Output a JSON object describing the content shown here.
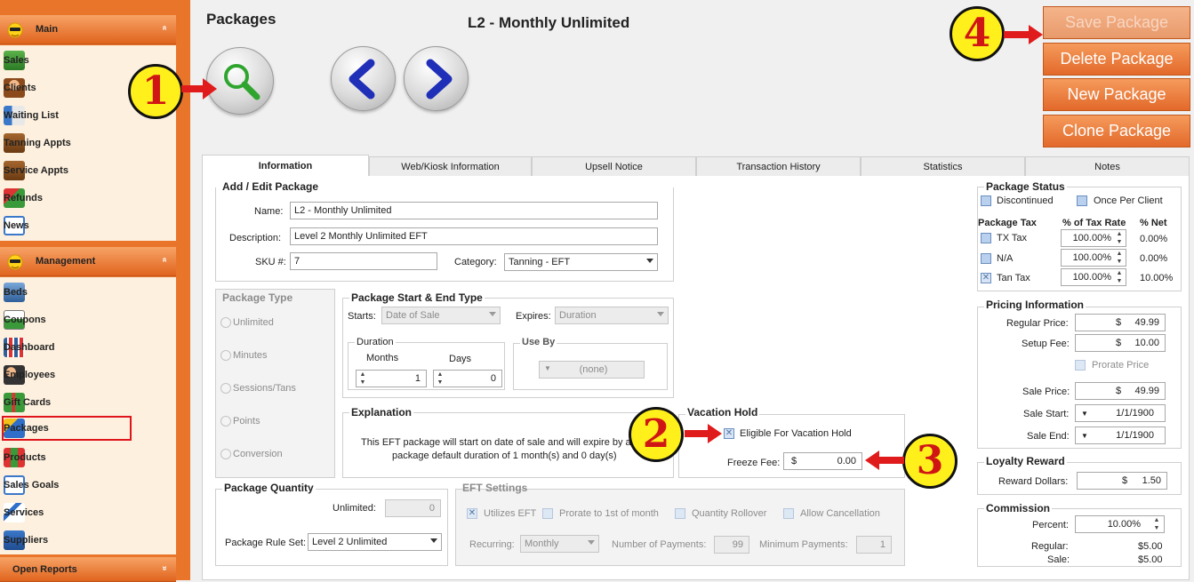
{
  "sidebar": {
    "main_section": {
      "label": "Main",
      "chevron": "»"
    },
    "main_items": [
      {
        "label": "Sales",
        "icon": "sales-icon"
      },
      {
        "label": "Clients",
        "icon": "clients-icon"
      },
      {
        "label": "Waiting List",
        "icon": "waiting-list-icon"
      },
      {
        "label": "Tanning Appts",
        "icon": "tanning-appts-icon"
      },
      {
        "label": "Service Appts",
        "icon": "service-appts-icon"
      },
      {
        "label": "Refunds",
        "icon": "refunds-icon"
      },
      {
        "label": "News",
        "icon": "news-icon"
      }
    ],
    "management_section": {
      "label": "Management",
      "chevron": "»"
    },
    "management_items": [
      {
        "label": "Beds",
        "icon": "beds-icon"
      },
      {
        "label": "Coupons",
        "icon": "coupons-icon"
      },
      {
        "label": "Dashboard",
        "icon": "dashboard-icon"
      },
      {
        "label": "Employees",
        "icon": "employees-icon"
      },
      {
        "label": "Gift Cards",
        "icon": "gift-cards-icon"
      },
      {
        "label": "Packages",
        "icon": "packages-icon"
      },
      {
        "label": "Products",
        "icon": "products-icon"
      },
      {
        "label": "Sales Goals",
        "icon": "sales-goals-icon"
      },
      {
        "label": "Services",
        "icon": "services-icon"
      },
      {
        "label": "Suppliers",
        "icon": "suppliers-icon"
      }
    ],
    "reports_section": {
      "label": "Open Reports",
      "chevron": "»"
    }
  },
  "header": {
    "page_title": "Packages",
    "package_title": "L2 - Monthly Unlimited"
  },
  "callouts": [
    "1",
    "2",
    "3",
    "4"
  ],
  "actions": {
    "save": "Save Package",
    "delete": "Delete Package",
    "new": "New Package",
    "clone": "Clone Package"
  },
  "tabs": [
    "Information",
    "Web/Kiosk Information",
    "Upsell Notice",
    "Transaction History",
    "Statistics",
    "Notes"
  ],
  "add_edit": {
    "title": "Add / Edit Package",
    "name_label": "Name:",
    "name_value": "L2 - Monthly Unlimited",
    "description_label": "Description:",
    "description_value": "Level 2 Monthly Unlimited EFT",
    "sku_label": "SKU #:",
    "sku_value": "7",
    "category_label": "Category:",
    "category_value": "Tanning - EFT"
  },
  "package_type": {
    "title": "Package Type",
    "options": [
      "Unlimited",
      "Minutes",
      "Sessions/Tans",
      "Points",
      "Conversion"
    ]
  },
  "start_end": {
    "title": "Package Start & End Type",
    "starts_label": "Starts:",
    "starts_value": "Date of Sale",
    "expires_label": "Expires:",
    "expires_value": "Duration",
    "duration_title": "Duration",
    "months_label": "Months",
    "months_value": "1",
    "days_label": "Days",
    "days_value": "0",
    "use_by_title": "Use By",
    "use_by_value": "(none)"
  },
  "explanation": {
    "title": "Explanation",
    "line1": "This EFT package will start on date of sale and will expire by a",
    "line2": "package default duration of 1 month(s) and 0 day(s)"
  },
  "vacation_hold": {
    "title": "Vacation Hold",
    "eligible_label": "Eligible For Vacation Hold",
    "eligible_checked": true,
    "freeze_fee_label": "Freeze Fee:",
    "freeze_fee_currency": "$",
    "freeze_fee_value": "0.00"
  },
  "package_quantity": {
    "title": "Package Quantity",
    "unlimited_label": "Unlimited:",
    "unlimited_value": "0",
    "rule_set_label": "Package Rule Set:",
    "rule_set_value": "Level 2 Unlimited"
  },
  "eft_settings": {
    "title": "EFT Settings",
    "utilizes_eft": "Utilizes EFT",
    "prorate": "Prorate to 1st of month",
    "quantity_rollover": "Quantity Rollover",
    "allow_cancellation": "Allow Cancellation",
    "recurring_label": "Recurring:",
    "recurring_value": "Monthly",
    "num_payments_label": "Number of Payments:",
    "num_payments_value": "99",
    "min_payments_label": "Minimum Payments:",
    "min_payments_value": "1"
  },
  "package_status": {
    "title": "Package Status",
    "discontinued": "Discontinued",
    "once_per_client": "Once Per Client",
    "tax_header": "Package Tax",
    "rate_header": "% of Tax Rate",
    "net_header": "% Net",
    "taxes": [
      {
        "name": "TX Tax",
        "rate": "100.00%",
        "net": "0.00%",
        "checked": false
      },
      {
        "name": "N/A",
        "rate": "100.00%",
        "net": "0.00%",
        "checked": false
      },
      {
        "name": "Tan Tax",
        "rate": "100.00%",
        "net": "10.00%",
        "checked": true
      }
    ]
  },
  "pricing": {
    "title": "Pricing Information",
    "regular_label": "Regular Price:",
    "regular_value": "49.99",
    "setup_label": "Setup Fee:",
    "setup_value": "10.00",
    "prorate_label": "Prorate Price",
    "sale_price_label": "Sale Price:",
    "sale_price_value": "49.99",
    "sale_start_label": "Sale Start:",
    "sale_start_value": "1/1/1900",
    "sale_end_label": "Sale End:",
    "sale_end_value": "1/1/1900",
    "currency": "$"
  },
  "loyalty": {
    "title": "Loyalty Reward",
    "reward_label": "Reward Dollars:",
    "reward_value": "1.50",
    "currency": "$"
  },
  "commission": {
    "title": "Commission",
    "percent_label": "Percent:",
    "percent_value": "10.00%",
    "regular_label": "Regular:",
    "regular_value": "$5.00",
    "sale_label": "Sale:",
    "sale_value": "$5.00"
  },
  "colors": {
    "sidebar": "#e8752a",
    "action_button": "#e2692a",
    "callout_fill": "#ffef1a",
    "callout_text": "#d01515",
    "highlight": "#e0141b"
  }
}
